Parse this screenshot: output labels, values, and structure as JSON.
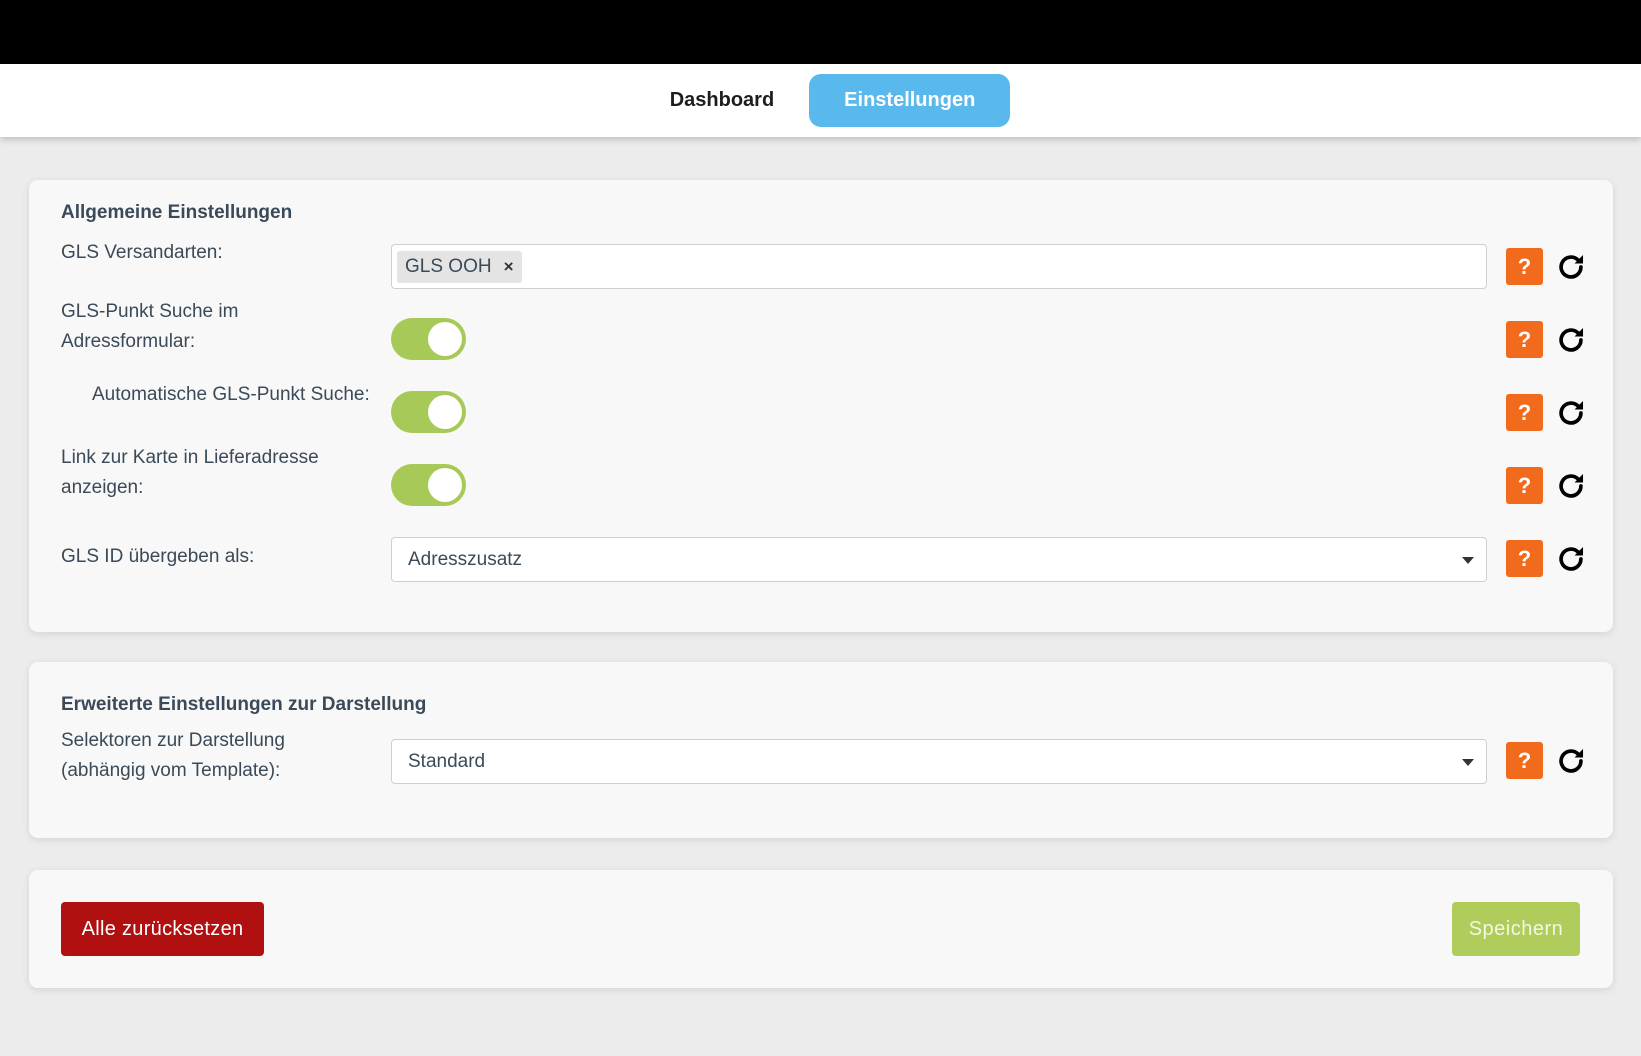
{
  "nav": {
    "tabs": [
      {
        "label": "Dashboard",
        "active": false
      },
      {
        "label": "Einstellungen",
        "active": true
      }
    ]
  },
  "general": {
    "title": "Allgemeine Einstellungen",
    "shipping_methods": {
      "label": "GLS Versandarten:",
      "tags": [
        "GLS OOH"
      ],
      "remove_icon": "×"
    },
    "parcelshop_search": {
      "label": "GLS-Punkt Suche im Adressformular:",
      "enabled": true
    },
    "auto_parcelshop_search": {
      "label": "Automatische GLS-Punkt Suche:",
      "enabled": true
    },
    "map_link": {
      "label": "Link zur Karte in Lieferadresse anzeigen:",
      "enabled": true
    },
    "gls_id_as": {
      "label": "GLS ID übergeben als:",
      "value": "Adresszusatz"
    }
  },
  "display": {
    "title": "Erweiterte Einstellungen zur Darstellung",
    "selectors": {
      "label": "Selektoren zur Darstellung (abhängig vom Template):",
      "value": "Standard"
    }
  },
  "icons": {
    "help": "?",
    "help_name": "help-icon",
    "reset_name": "reset-icon"
  },
  "colors": {
    "accent_tab": "#5ab9ec",
    "toggle_on": "#a7c957",
    "help_button": "#f26a1c",
    "danger_button": "#b01010",
    "save_button": "#b0cc5a"
  },
  "actions": {
    "reset_all": "Alle zurücksetzen",
    "save": "Speichern"
  }
}
